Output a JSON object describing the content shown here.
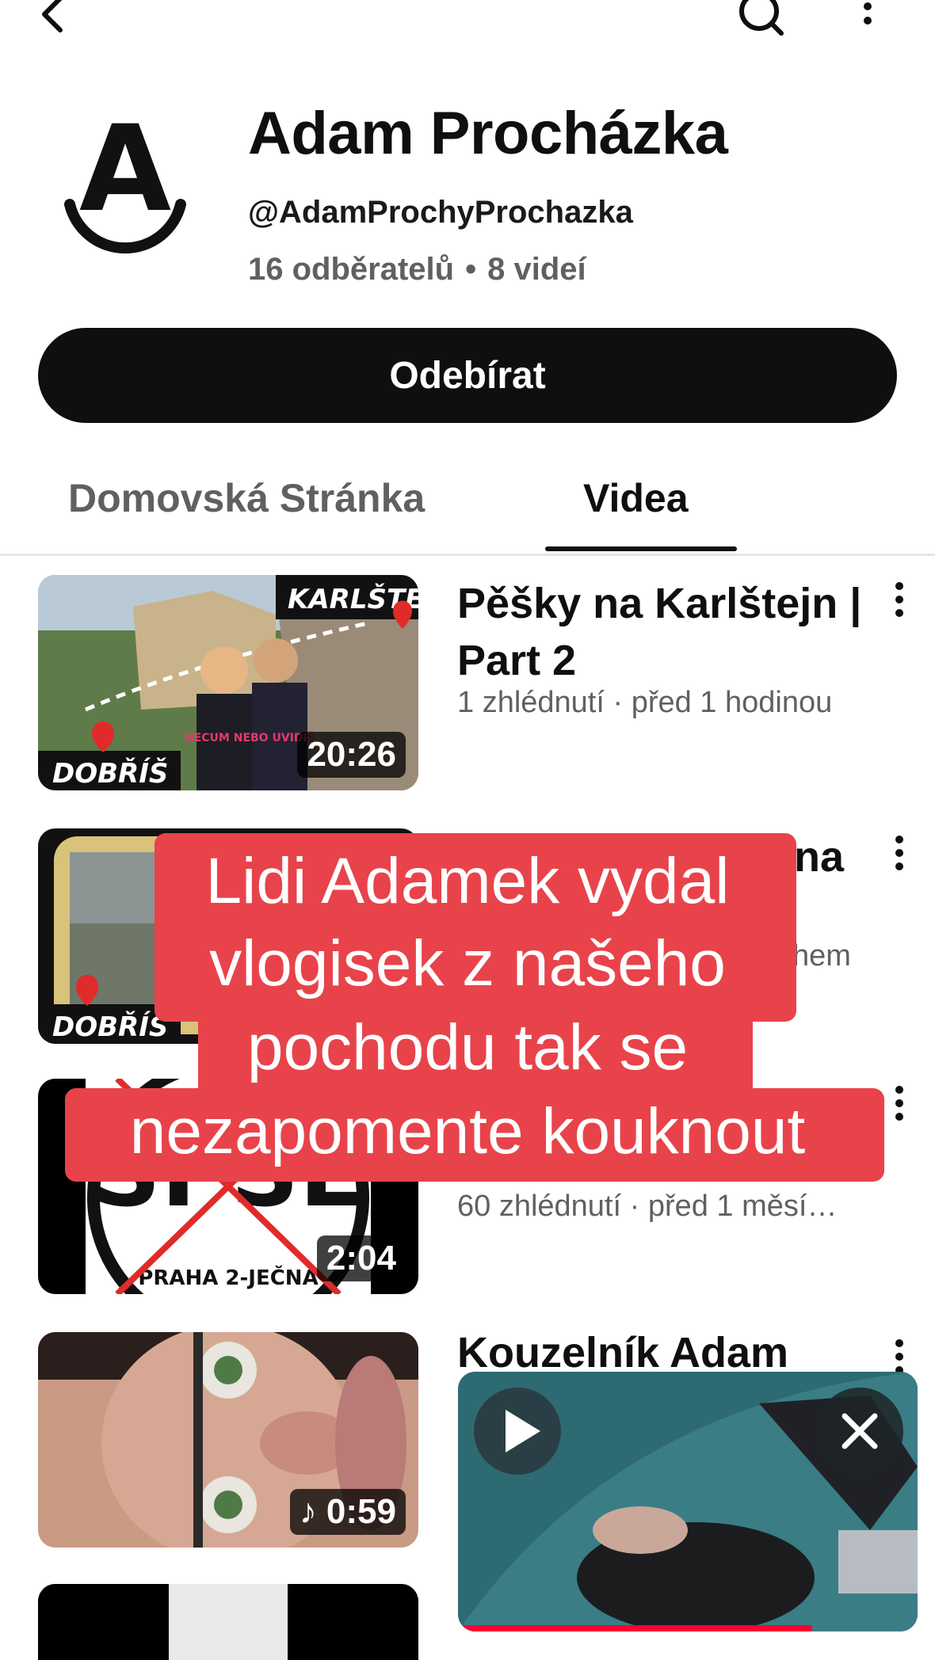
{
  "channel": {
    "name": "Adam Procházka",
    "handle": "@AdamProchyProchazka",
    "subscribers": "16 odběratelů",
    "separator": "•",
    "video_count": "8 videí",
    "subscribe_label": "Odebírat"
  },
  "tabs": [
    {
      "label": "Domovská Stránka",
      "active": false
    },
    {
      "label": "Videa",
      "active": true
    }
  ],
  "videos": [
    {
      "title": "Pěšky na Karlštejn | Part 2",
      "meta": "1 zhlédnutí · před 1 hodinou",
      "duration": "20:26",
      "thumb_text": [
        "KARLŠTEJN",
        "DOBŘÍŠ",
        "NECUM NEBO UVIDIŠ"
      ]
    },
    {
      "title": "na",
      "meta": "hem",
      "duration": "",
      "thumb_text": [
        "DOBŘÍŠ"
      ]
    },
    {
      "title": "",
      "meta": "60 zhlédnutí · před 1 měsí…",
      "duration": "2:04",
      "thumb_text": [
        "PRAHA 2-JEČNÁ"
      ]
    },
    {
      "title": "Kouzelník Adam",
      "meta": "",
      "duration": "0:59",
      "is_short": true
    }
  ],
  "overlay_caption": {
    "lines": [
      "Lidi Adamek vydal",
      "vlogisek z našeho",
      "pochodu tak se",
      "nezapomente kouknout"
    ],
    "background": "#e8434a",
    "text_color": "#ffffff"
  },
  "mini_player": {
    "progress": 0.77
  },
  "colors": {
    "primary_text": "#0f0f0f",
    "secondary_text": "#606060",
    "subscribe_bg": "#0f0f0f",
    "progress_red": "#ff0033"
  }
}
